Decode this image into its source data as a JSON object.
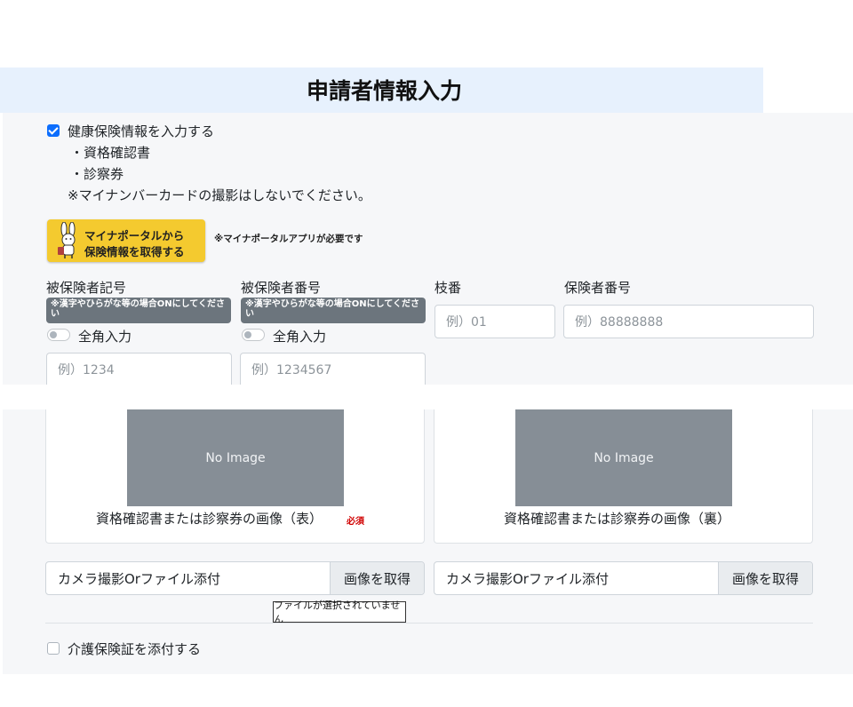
{
  "page": {
    "title": "申請者情報入力"
  },
  "health_insurance": {
    "checkbox_label": "健康保険情報を入力する",
    "checked": true,
    "items": [
      "・資格確認書",
      "・診察券"
    ],
    "note": "※マイナンバーカードの撮影はしないでください。"
  },
  "mynaportal": {
    "button_line1": "マイナポータルから",
    "button_line2": "保険情報を取得する",
    "note": "※マイナポータルアプリが必要です"
  },
  "fields": {
    "symbol": {
      "label": "被保険者記号",
      "hint": "※漢字やひらがな等の場合ONにしてください",
      "toggle_label": "全角入力",
      "toggle_on": false,
      "placeholder": "例）1234"
    },
    "number": {
      "label": "被保険者番号",
      "hint": "※漢字やひらがな等の場合ONにしてください",
      "toggle_label": "全角入力",
      "toggle_on": false,
      "placeholder": "例）1234567"
    },
    "branch": {
      "label": "枝番",
      "placeholder": "例）01"
    },
    "insurer": {
      "label": "保険者番号",
      "placeholder": "例）88888888"
    }
  },
  "images": {
    "front": {
      "no_image": "No Image",
      "caption": "資格確認書または診察券の画像（表）",
      "required": "必須"
    },
    "back": {
      "no_image": "No Image",
      "caption": "資格確認書または診察券の画像（裏）"
    }
  },
  "file_inputs": {
    "front": {
      "text": "カメラ撮影Orファイル添付",
      "button": "画像を取得"
    },
    "back": {
      "text": "カメラ撮影Orファイル添付",
      "button": "画像を取得"
    },
    "tooltip": "ファイルが選択されていません"
  },
  "care_insurance": {
    "checkbox_label": "介護保険証を添付する",
    "checked": false
  }
}
